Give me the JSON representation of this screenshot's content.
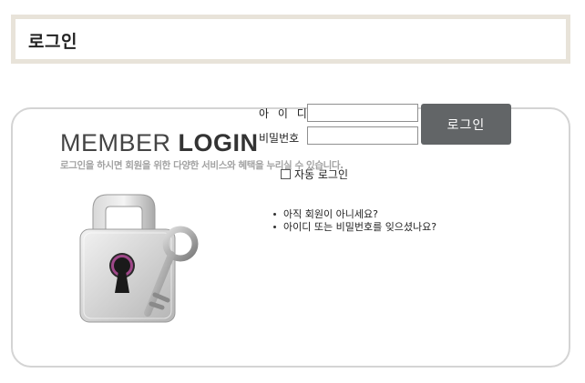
{
  "page_title": "로그인",
  "login_panel": {
    "heading_light": "MEMBER",
    "heading_bold": "LOGIN",
    "subtitle": "로그인을 하시면 회원을 위한 다양한 서비스와 혜택을 누리실 수 있습니다.",
    "id_label": "아 이 디",
    "password_label": "비밀번호",
    "id_value": "",
    "password_value": "",
    "login_button": "로그인",
    "auto_login_label": "자동 로그인",
    "auto_login_checked": false,
    "links": [
      "아직 회원이 아니세요?",
      "아이디 또는 비밀번호를 잊으셨나요?"
    ]
  },
  "icons": [
    "lock-icon",
    "key-icon",
    "checkbox-icon"
  ],
  "colors": {
    "title_border": "#e8e3d9",
    "card_border": "#d4d4d4",
    "button_bg": "#626567",
    "button_text": "#ffffff",
    "subtitle_text": "#a3a3a3"
  }
}
